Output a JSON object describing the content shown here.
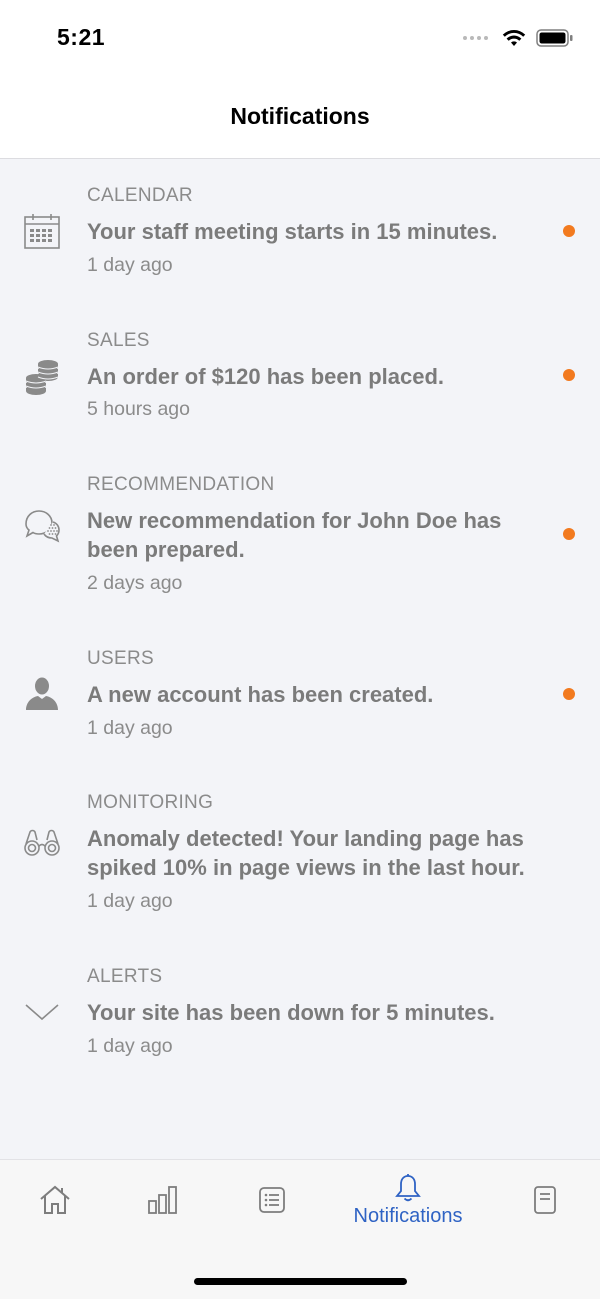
{
  "status_bar": {
    "time": "5:21"
  },
  "header": {
    "title": "Notifications"
  },
  "notifications": [
    {
      "category": "CALENDAR",
      "message": "Your staff meeting starts in 15 minutes.",
      "time_ago": "1 day ago",
      "icon": "calendar-icon",
      "unread": true
    },
    {
      "category": "SALES",
      "message": "An order of $120 has been placed.",
      "time_ago": "5 hours ago",
      "icon": "coins-icon",
      "unread": true
    },
    {
      "category": "RECOMMENDATION",
      "message": "New recommendation for John Doe has been prepared.",
      "time_ago": "2 days ago",
      "icon": "chat-bubbles-icon",
      "unread": true
    },
    {
      "category": "USERS",
      "message": "A new account has been created.",
      "time_ago": "1 day ago",
      "icon": "user-icon",
      "unread": true
    },
    {
      "category": "MONITORING",
      "message": "Anomaly detected! Your landing page has spiked 10% in page views in the last hour.",
      "time_ago": "1 day ago",
      "icon": "binoculars-icon",
      "unread": false
    },
    {
      "category": "ALERTS",
      "message": "Your site has been down for 5 minutes.",
      "time_ago": "1 day ago",
      "icon": "chevron-down-icon",
      "unread": false
    }
  ],
  "tab_bar": {
    "tabs": [
      {
        "icon": "home-icon",
        "label": ""
      },
      {
        "icon": "bar-chart-icon",
        "label": ""
      },
      {
        "icon": "list-icon",
        "label": ""
      },
      {
        "icon": "bell-icon",
        "label": "Notifications",
        "active": true
      },
      {
        "icon": "document-icon",
        "label": ""
      }
    ]
  },
  "colors": {
    "accent": "#2f63c4",
    "unread_dot": "#f27a1f",
    "background": "#f3f4f8"
  }
}
